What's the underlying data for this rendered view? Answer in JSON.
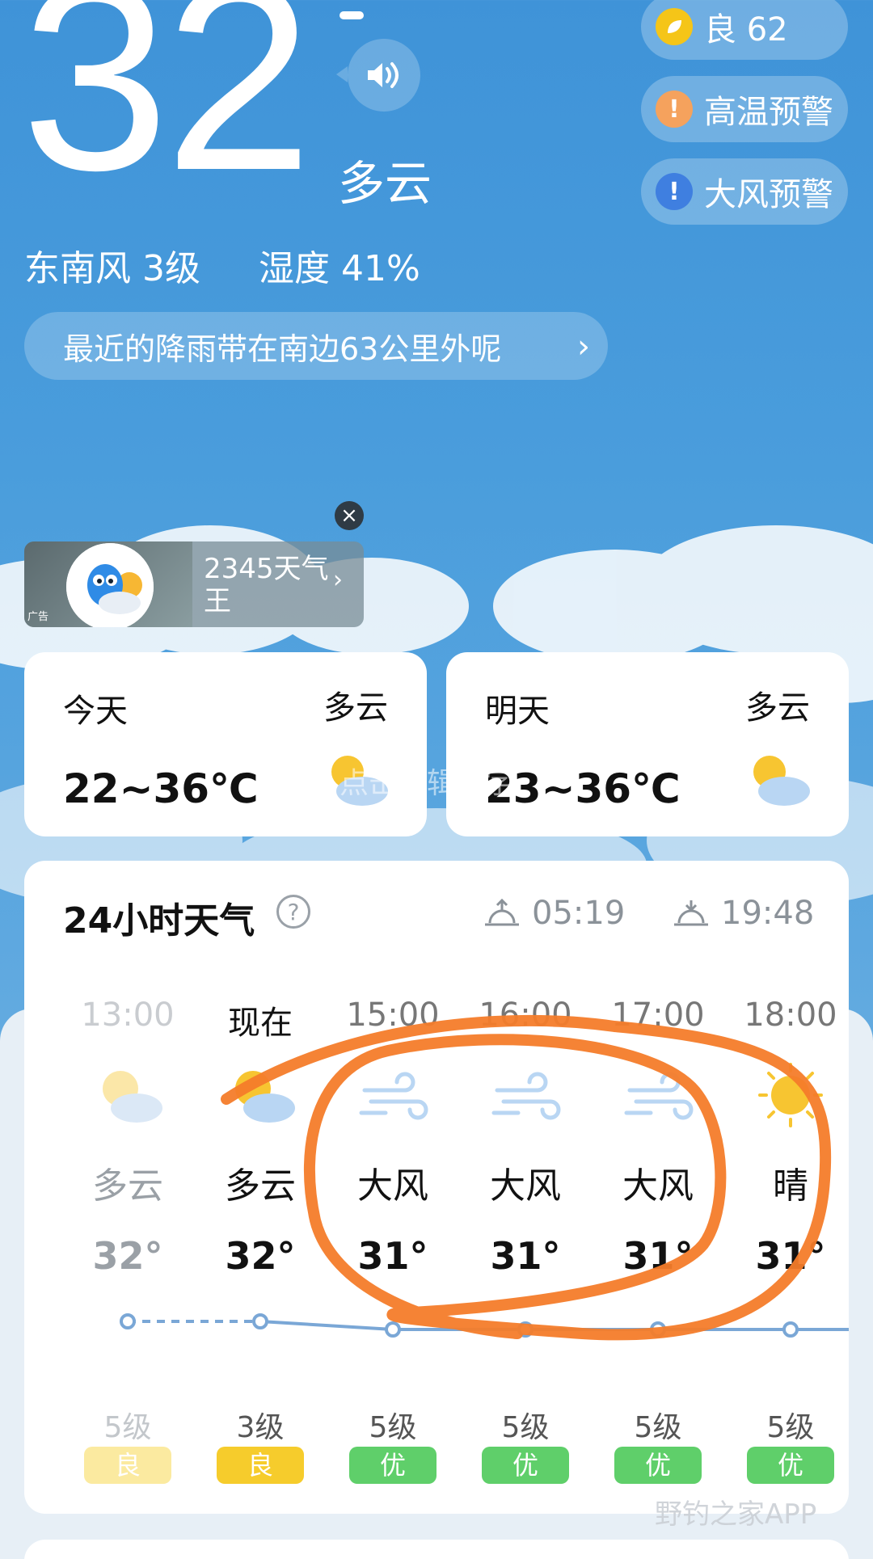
{
  "current": {
    "temperature": "32",
    "condition": "多云",
    "wind": "东南风 3级",
    "humidity": "湿度 41%",
    "rain_notice": "最近的降雨带在南边63公里外呢",
    "speaker_icon": "speaker-icon"
  },
  "badges": [
    {
      "label": "良 62",
      "color": "#f5c518",
      "icon": "leaf-icon"
    },
    {
      "label": "高温预警",
      "color": "#f5a25d",
      "icon": "exclamation-icon"
    },
    {
      "label": "大风预警",
      "color": "#3f7fe0",
      "icon": "exclamation-icon"
    }
  ],
  "ad": {
    "title": "2345天气王",
    "tag": "广告"
  },
  "days": [
    {
      "label": "今天",
      "condition": "多云",
      "range": "22~36℃"
    },
    {
      "label": "明天",
      "condition": "多云",
      "range": "23~36℃"
    }
  ],
  "watermark": "点击编辑文字",
  "hourly": {
    "title": "24小时天气",
    "sunrise": "05:19",
    "sunset": "19:48",
    "items": [
      {
        "time": "13:00",
        "icon": "partly-cloudy-icon",
        "condition": "多云",
        "temp": "32°",
        "wind": "5级",
        "aqi": "良",
        "aqi_color": "#fbeaa0"
      },
      {
        "time": "现在",
        "icon": "partly-cloudy-icon",
        "condition": "多云",
        "temp": "32°",
        "wind": "3级",
        "aqi": "良",
        "aqi_color": "#f6cc2c"
      },
      {
        "time": "15:00",
        "icon": "wind-icon",
        "condition": "大风",
        "temp": "31°",
        "wind": "5级",
        "aqi": "优",
        "aqi_color": "#5fcf6a"
      },
      {
        "time": "16:00",
        "icon": "wind-icon",
        "condition": "大风",
        "temp": "31°",
        "wind": "5级",
        "aqi": "优",
        "aqi_color": "#5fcf6a"
      },
      {
        "time": "17:00",
        "icon": "wind-icon",
        "condition": "大风",
        "temp": "31°",
        "wind": "5级",
        "aqi": "优",
        "aqi_color": "#5fcf6a"
      },
      {
        "time": "18:00",
        "icon": "sun-icon",
        "condition": "晴",
        "temp": "31°",
        "wind": "5级",
        "aqi": "优",
        "aqi_color": "#5fcf6a"
      }
    ]
  },
  "footer_watermark": "野钓之家APP",
  "colors": {
    "accent_line": "#7aa7d6",
    "annotation": "#f47c2a"
  }
}
